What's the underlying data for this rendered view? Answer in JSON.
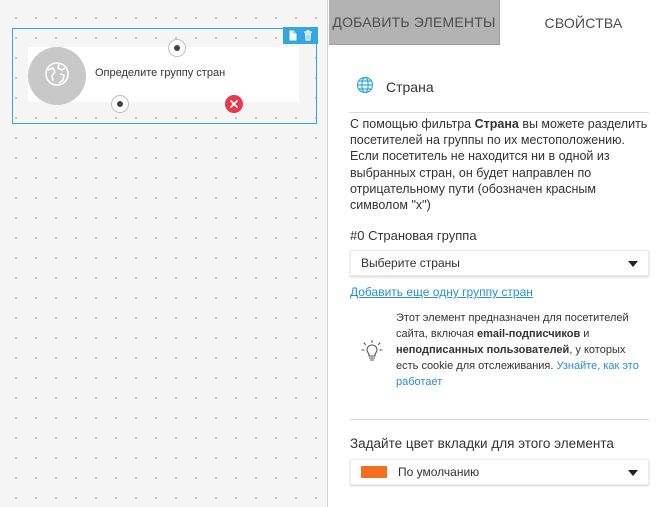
{
  "canvas": {
    "node": {
      "label": "Определите группу стран",
      "icon": "globe-icon"
    }
  },
  "tabs": {
    "add_elements": "ДОБАВИТЬ ЭЛЕМЕНТЫ",
    "properties": "СВОЙСТВА"
  },
  "panel": {
    "title": "Страна",
    "description": {
      "part1": "С помощью фильтра ",
      "bold": "Страна",
      "part2": " вы можете разделить посетителей на группы по их местоположению. Если посетитель не находится ни в одной из выбранных стран, он будет направлен по отрицательному пути (обозначен красным символом \"x\")"
    },
    "group_title": "#0 Страновая группа",
    "country_select": {
      "value": "Выберите страны"
    },
    "add_group_link": "Добавить еще одну группу стран",
    "info": {
      "t1": "Этот элемент предназначен для посетителей сайта, включая ",
      "b1": "email-подписчиков",
      "t2": " и ",
      "b2": "неподписанных пользователей",
      "t3": ", у которых есть cookie для отслеживания. ",
      "link": "Узнайте, как это работает"
    },
    "color_title": "Задайте цвет вкладки для этого элемента",
    "color_select": {
      "value": "По умолчанию",
      "swatch": "#f37021"
    }
  },
  "colors": {
    "accent": "#34a7e0",
    "negative": "#e8364b",
    "link": "#2a8fd4"
  }
}
